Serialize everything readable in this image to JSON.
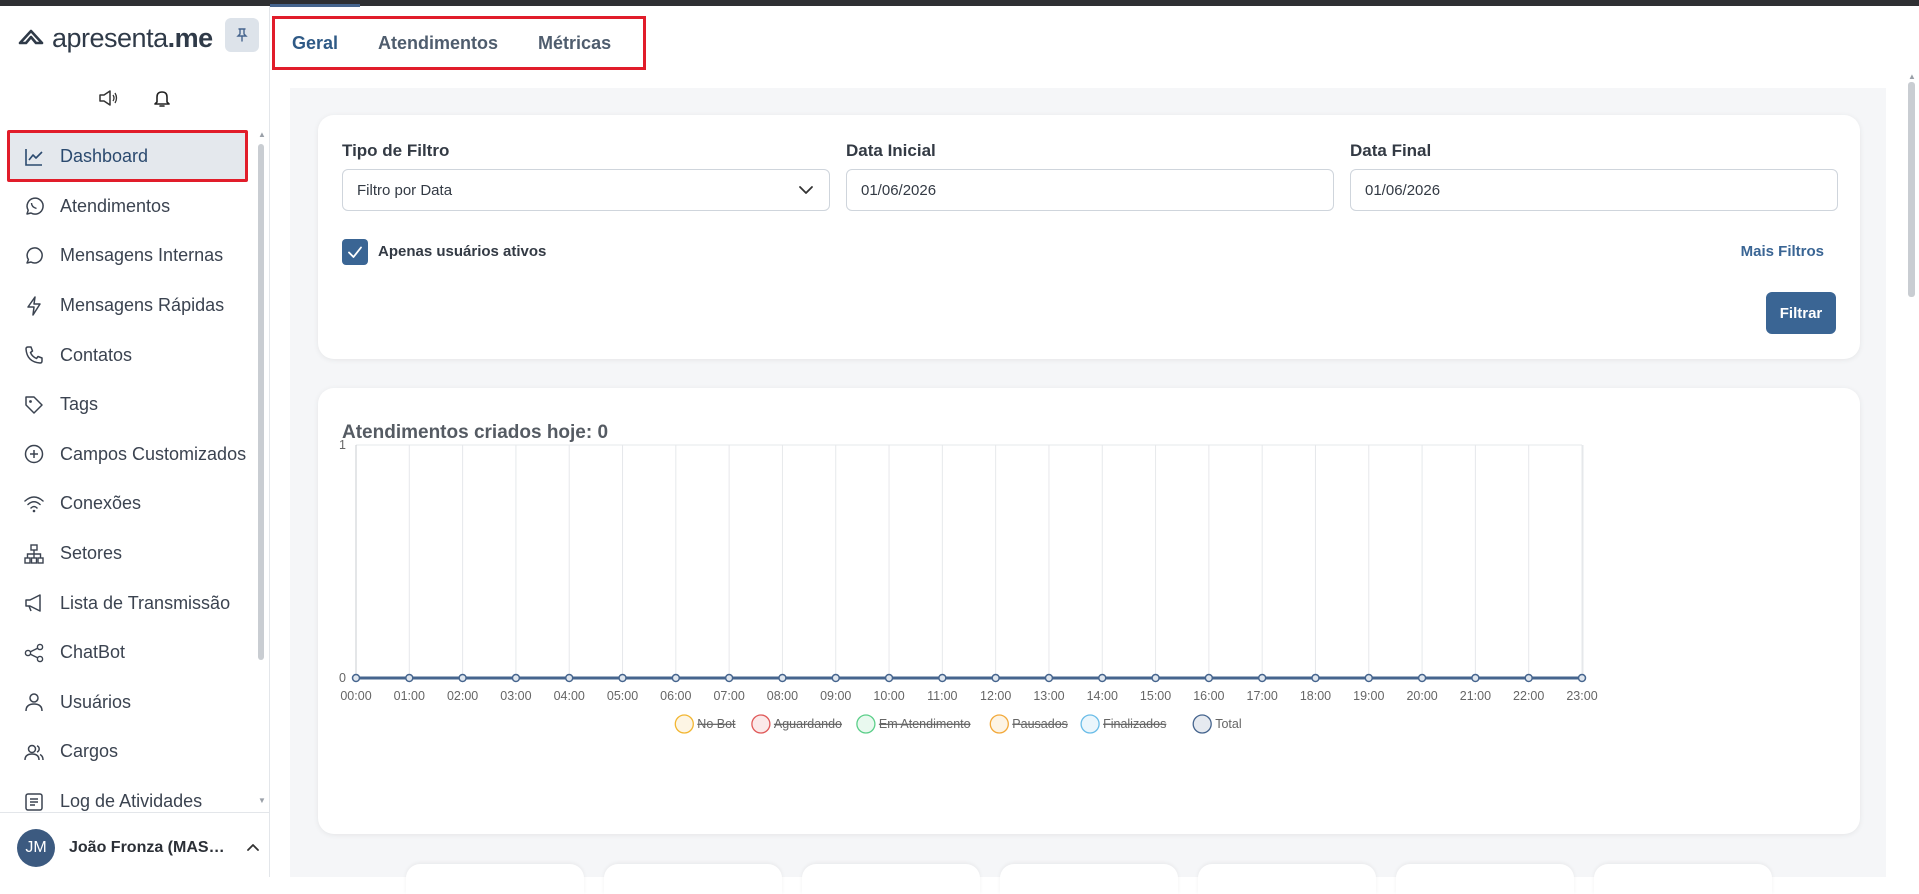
{
  "brand": {
    "name_light": "apresenta",
    "name_bold": ".me"
  },
  "sidebar": {
    "items": [
      {
        "label": "Dashboard",
        "icon": "chart-line-icon"
      },
      {
        "label": "Atendimentos",
        "icon": "whatsapp-icon"
      },
      {
        "label": "Mensagens Internas",
        "icon": "chat-bubble-icon"
      },
      {
        "label": "Mensagens Rápidas",
        "icon": "lightning-icon"
      },
      {
        "label": "Contatos",
        "icon": "phone-icon"
      },
      {
        "label": "Tags",
        "icon": "tag-icon"
      },
      {
        "label": "Campos Customizados",
        "icon": "plus-circle-icon"
      },
      {
        "label": "Conexões",
        "icon": "wifi-icon"
      },
      {
        "label": "Setores",
        "icon": "hierarchy-icon"
      },
      {
        "label": "Lista de Transmissão",
        "icon": "megaphone-icon"
      },
      {
        "label": "ChatBot",
        "icon": "share-nodes-icon"
      },
      {
        "label": "Usuários",
        "icon": "user-icon"
      },
      {
        "label": "Cargos",
        "icon": "users-icon"
      },
      {
        "label": "Log de Atividades",
        "icon": "list-icon"
      }
    ],
    "user": {
      "initials": "JM",
      "name": "João Fronza (MAST..."
    }
  },
  "tabs": [
    "Geral",
    "Atendimentos",
    "Métricas"
  ],
  "filters": {
    "type_label": "Tipo de Filtro",
    "type_value": "Filtro por Data",
    "start_label": "Data Inicial",
    "start_value": "01/06/2026",
    "end_label": "Data Final",
    "end_value": "01/06/2026",
    "active_only_label": "Apenas usuários ativos",
    "active_only_checked": true,
    "more_filters": "Mais Filtros",
    "submit": "Filtrar"
  },
  "colors": {
    "accent": "#3a6594",
    "highlight": "#e11d2a"
  },
  "chart_data": {
    "type": "line",
    "title": "Atendimentos criados hoje: 0",
    "x": [
      "00:00",
      "01:00",
      "02:00",
      "03:00",
      "04:00",
      "05:00",
      "06:00",
      "07:00",
      "08:00",
      "09:00",
      "10:00",
      "11:00",
      "12:00",
      "13:00",
      "14:00",
      "15:00",
      "16:00",
      "17:00",
      "18:00",
      "19:00",
      "20:00",
      "21:00",
      "22:00",
      "23:00"
    ],
    "ylim": [
      0,
      1
    ],
    "yticks": [
      "0",
      "1"
    ],
    "grid": true,
    "legend_position": "bottom",
    "series": [
      {
        "name": "No Bot",
        "color": "#f2b632",
        "hidden": true,
        "values": [
          0,
          0,
          0,
          0,
          0,
          0,
          0,
          0,
          0,
          0,
          0,
          0,
          0,
          0,
          0,
          0,
          0,
          0,
          0,
          0,
          0,
          0,
          0,
          0
        ]
      },
      {
        "name": "Aguardando",
        "color": "#e05a5a",
        "hidden": true,
        "values": [
          0,
          0,
          0,
          0,
          0,
          0,
          0,
          0,
          0,
          0,
          0,
          0,
          0,
          0,
          0,
          0,
          0,
          0,
          0,
          0,
          0,
          0,
          0,
          0
        ]
      },
      {
        "name": "Em Atendimento",
        "color": "#5ccf8a",
        "hidden": true,
        "values": [
          0,
          0,
          0,
          0,
          0,
          0,
          0,
          0,
          0,
          0,
          0,
          0,
          0,
          0,
          0,
          0,
          0,
          0,
          0,
          0,
          0,
          0,
          0,
          0
        ]
      },
      {
        "name": "Pausados",
        "color": "#f2a93b",
        "hidden": true,
        "values": [
          0,
          0,
          0,
          0,
          0,
          0,
          0,
          0,
          0,
          0,
          0,
          0,
          0,
          0,
          0,
          0,
          0,
          0,
          0,
          0,
          0,
          0,
          0,
          0
        ]
      },
      {
        "name": "Finalizados",
        "color": "#6bbde8",
        "hidden": true,
        "values": [
          0,
          0,
          0,
          0,
          0,
          0,
          0,
          0,
          0,
          0,
          0,
          0,
          0,
          0,
          0,
          0,
          0,
          0,
          0,
          0,
          0,
          0,
          0,
          0
        ]
      },
      {
        "name": "Total",
        "color": "#46658e",
        "hidden": false,
        "values": [
          0,
          0,
          0,
          0,
          0,
          0,
          0,
          0,
          0,
          0,
          0,
          0,
          0,
          0,
          0,
          0,
          0,
          0,
          0,
          0,
          0,
          0,
          0,
          0
        ]
      }
    ]
  }
}
